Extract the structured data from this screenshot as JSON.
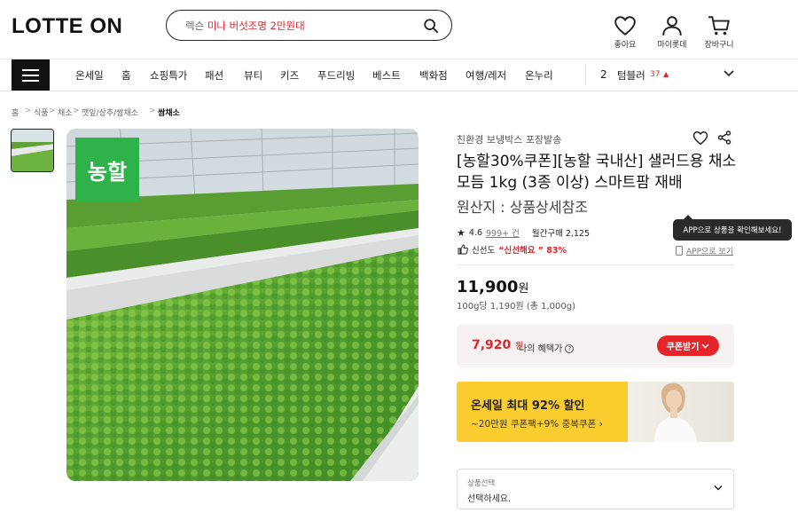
{
  "header": {
    "logo": "LOTTE ON",
    "search_prefix": "렉슨",
    "search_highlight": "미나 버섯조명 2만원대",
    "icons": [
      {
        "name": "heart-icon",
        "label": "좋아요"
      },
      {
        "name": "user-icon",
        "label": "마이롯데"
      },
      {
        "name": "cart-icon",
        "label": "장바구니"
      }
    ]
  },
  "gnb": {
    "items": [
      "온세일",
      "홈",
      "쇼핑특가",
      "패션",
      "뷰티",
      "키즈",
      "푸드리빙",
      "베스트",
      "백화점",
      "여행/레저",
      "온누리"
    ],
    "rank_number": "2",
    "rank_keyword": "텀블러",
    "rank_count": "37"
  },
  "breadcrumb": [
    "홈",
    "식품",
    "채소",
    "깻잎/상추/쌈채소",
    "쌈채소"
  ],
  "product": {
    "badge": "농할",
    "store": "친환경 보냉박스 포장발송",
    "title": "[농할30%쿠폰][농할 국내산] 샐러드용 채소 모듬 1kg (3종 이상) 스마트팜 재배",
    "origin": "원산지 : 상품상세참조",
    "rating": "4.6",
    "reviews": "999+ 건",
    "monthly": "월간구매 2,125",
    "fresh_label": "신선도",
    "fresh_value": "“신선해요 ” 83%",
    "tooltip": "APP으로 상품을 확인해보세요!",
    "app_link": "APP으로 보기",
    "price": "11,900",
    "price_unit": "원",
    "unit_price": "100g당 1,190원 (총 1,000g)"
  },
  "benefit": {
    "price": "7,920",
    "price_unit": "원",
    "label": "나의 혜택가",
    "coupon_btn": "쿠폰받기"
  },
  "banner": {
    "title": "온세일 최대 92% 할인",
    "subtitle": "~20만원 쿠폰팩+9% 중복쿠폰"
  },
  "option": {
    "label": "상품선택",
    "value": "선택하세요."
  },
  "colors": {
    "accent": "#e5252a",
    "badge": "#2db34a",
    "banner": "#fccd2e"
  }
}
